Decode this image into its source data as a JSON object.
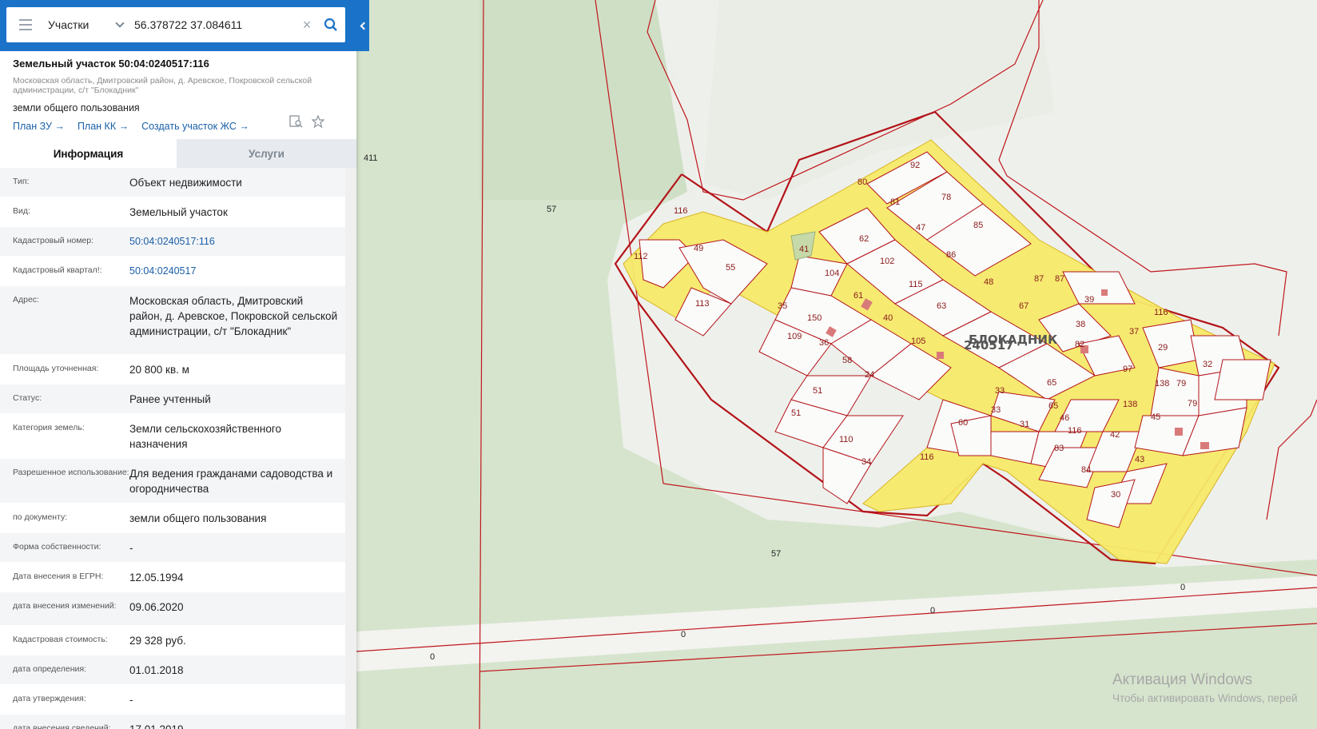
{
  "search": {
    "layer": "Участки",
    "query": "56.378722 37.084611"
  },
  "plot": {
    "title": "Земельный участок 50:04:0240517:116",
    "address": "Московская область, Дмитровский район, д. Аревское, Покровской сельской администрации, с/т \"Блокадник\"",
    "kind": "земли общего пользования",
    "links": [
      "План ЗУ →",
      "План КК →",
      "Создать участок ЖС →"
    ]
  },
  "tabs": [
    "Информация",
    "Услуги"
  ],
  "info_rows": [
    {
      "label": "Тип:",
      "value": "Объект недвижимости"
    },
    {
      "label": "Вид:",
      "value": "Земельный участок"
    },
    {
      "label": "Кадастровый номер:",
      "value": "50:04:0240517:116",
      "link": true
    },
    {
      "label": "Кадастровый квартал!:",
      "value": "50:04:0240517",
      "link": true
    },
    {
      "label": "Адрес:",
      "value": "Московская область, Дмитровский район, д. Аревское, Покровской сельской администрации, с/т \"Блокадник\""
    },
    {
      "label": "Площадь уточненная:",
      "value": "20 800 кв. м"
    },
    {
      "label": "Статус:",
      "value": "Ранее учтенный"
    },
    {
      "label": "Категория земель:",
      "value": "Земли сельскохозяйственного назначения"
    },
    {
      "label": "Разрешенное использование:",
      "value": "Для ведения гражданами садоводства и огородничества"
    },
    {
      "label": "по документу:",
      "value": "земли общего пользования"
    },
    {
      "label": "Форма собственности:",
      "value": "-"
    },
    {
      "label": "Дата внесения в ЕГРН:",
      "value": "12.05.1994"
    },
    {
      "label": "дата внесения изменений:",
      "value": "09.06.2020"
    },
    {
      "label": "Кадастровая стоимость:",
      "value": "29 328 руб."
    },
    {
      "label": "дата определения:",
      "value": "01.01.2018"
    },
    {
      "label": "дата утверждения:",
      "value": "-"
    },
    {
      "label": "дата внесения сведений:",
      "value": "17.01.2019"
    }
  ],
  "map": {
    "labels": [
      "411",
      "57",
      "57",
      "0",
      "0",
      "0",
      "0"
    ],
    "quarter_label": "БЛОКАДНИК",
    "quarter_code": "240517",
    "plot_numbers": [
      "112",
      "49",
      "55",
      "113",
      "116",
      "80",
      "92",
      "81",
      "78",
      "47",
      "85",
      "62",
      "41",
      "102",
      "86",
      "104",
      "115",
      "61",
      "35",
      "40",
      "63",
      "48",
      "67",
      "87",
      "87",
      "39",
      "38",
      "82",
      "105",
      "109",
      "150",
      "36",
      "58",
      "24",
      "51",
      "51",
      "110",
      "34",
      "116",
      "60",
      "33",
      "33",
      "31",
      "65",
      "65",
      "46",
      "116",
      "83",
      "84",
      "30",
      "37",
      "29",
      "32",
      "97",
      "138",
      "79",
      "138",
      "79",
      "45",
      "42",
      "43",
      "116"
    ]
  },
  "watermark": {
    "line1": "Активация Windows",
    "line2": "Чтобы активировать Windows, перей"
  },
  "colors": {
    "header_blue": "#1a73c8",
    "link_blue": "#1a5fa8",
    "boundary_red": "#c0161c",
    "plot_yellow": "#f7ea6b"
  }
}
